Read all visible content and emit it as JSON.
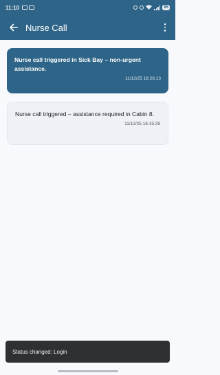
{
  "status_bar": {
    "time": "11:10",
    "battery": "85"
  },
  "app_bar": {
    "title": "Nurse Call",
    "back_icon": "arrow-left-icon",
    "menu_icon": "more-vertical-icon"
  },
  "notifications": [
    {
      "message": "Nurse call triggered in Sick Bay – non-urgent assistance.",
      "timestamp": "11/12/25 16:26:13",
      "highlighted": true
    },
    {
      "message": "Nurse call triggered – assistance required in Cabin 8.",
      "timestamp": "11/12/25 16:15:29",
      "highlighted": false
    }
  ],
  "snackbar": {
    "text": "Status changed: Login"
  },
  "colors": {
    "primary": "#2d6487",
    "background": "#f7f9fd",
    "card": "#eef1f5",
    "snackbar": "#2f3033"
  }
}
